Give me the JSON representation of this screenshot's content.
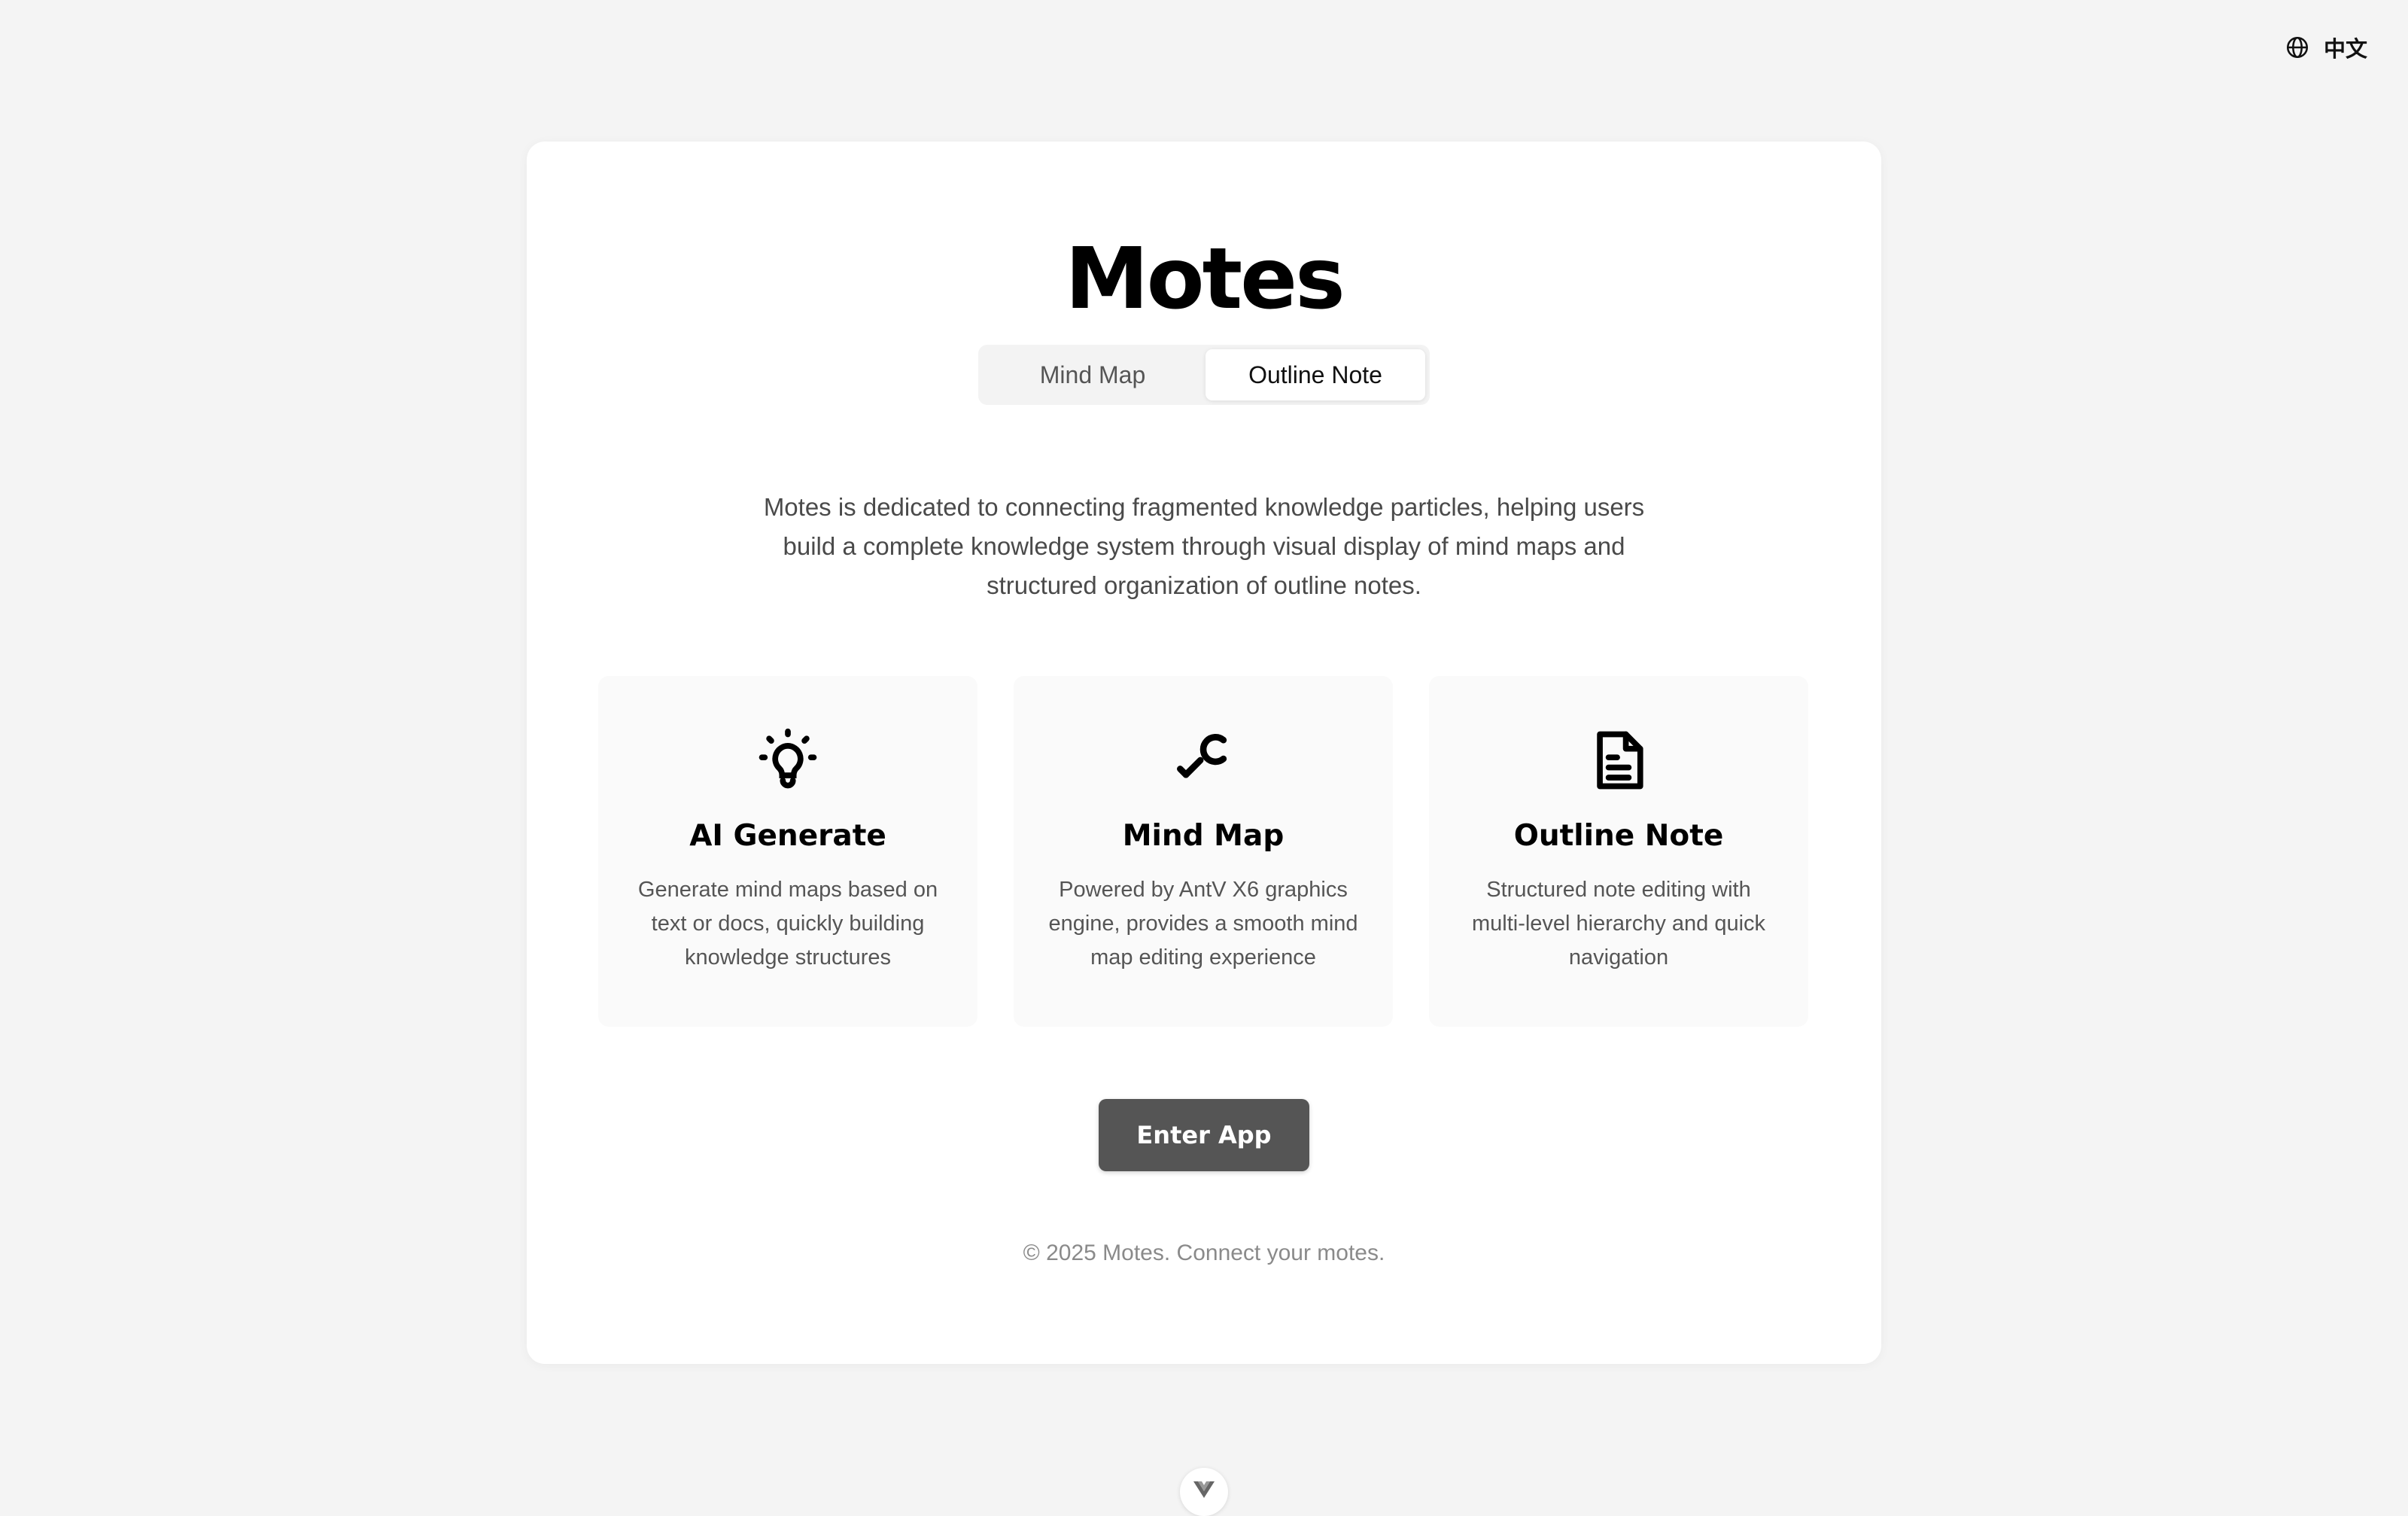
{
  "header": {
    "language_label": "中文",
    "language_icon": "globe-icon"
  },
  "hero": {
    "title": "Motes",
    "tabs": [
      {
        "label": "Mind Map",
        "active": false
      },
      {
        "label": "Outline Note",
        "active": true
      }
    ],
    "description": "Motes is dedicated to connecting fragmented knowledge particles, helping users build a complete knowledge system through visual display of mind maps and structured organization of outline notes."
  },
  "features": [
    {
      "icon": "lightbulb-icon",
      "title": "AI Generate",
      "description": "Generate mind maps based on text or docs, quickly building knowledge structures"
    },
    {
      "icon": "magnifier-icon",
      "title": "Mind Map",
      "description": "Powered by AntV X6 graphics engine, provides a smooth mind map editing experience"
    },
    {
      "icon": "document-icon",
      "title": "Outline Note",
      "description": "Structured note editing with multi-level hierarchy and quick navigation"
    }
  ],
  "actions": {
    "enter_label": "Enter App"
  },
  "footer": {
    "text": "© 2025 Motes. Connect your motes."
  },
  "devtools": {
    "icon": "vue-logo-icon"
  },
  "colors": {
    "page_background": "#f4f4f4",
    "card_background": "#ffffff",
    "button_background": "#555555",
    "feature_background": "#fafafa"
  }
}
